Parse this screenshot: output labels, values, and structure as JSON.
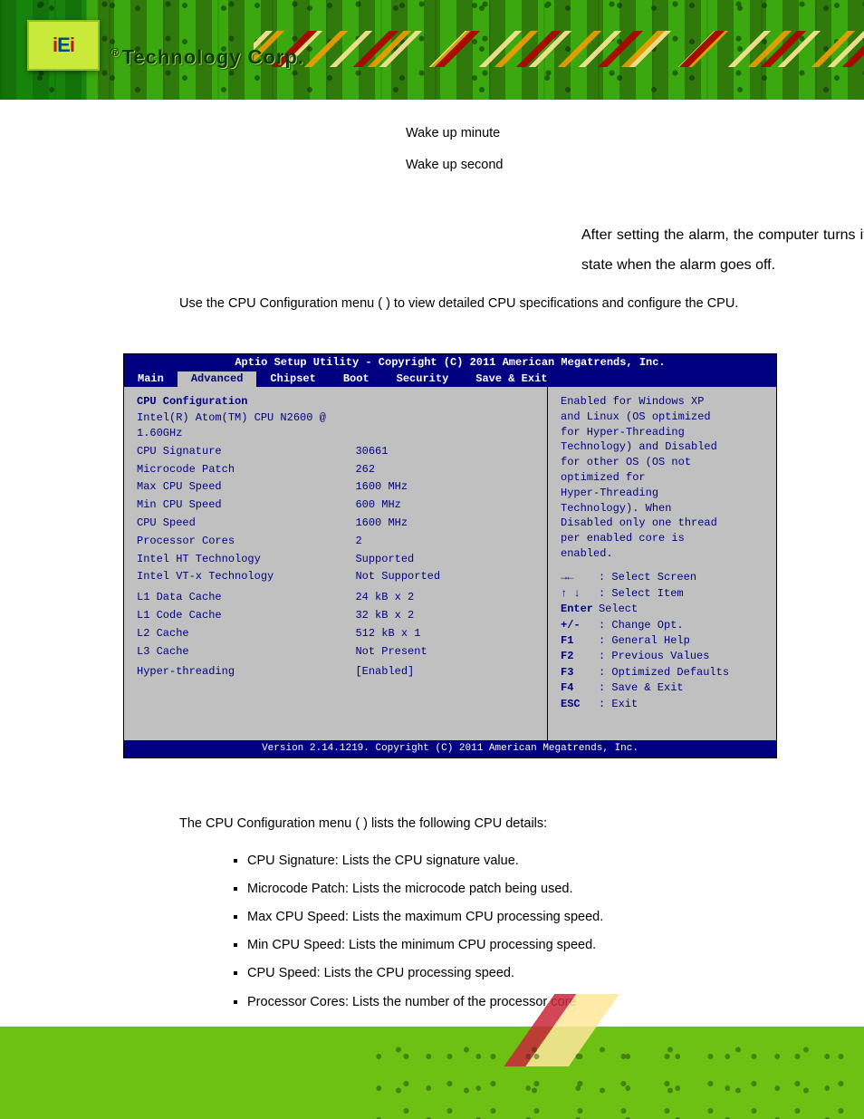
{
  "brand": {
    "logo_letters": "iEi",
    "logo_text": "Technology Corp."
  },
  "body": {
    "wake_minute": "Wake up minute",
    "wake_second": "Wake up second",
    "after_alarm": "After setting the alarm, the computer turns itself on from a suspend state when the alarm goes off.",
    "use_menu": "Use the CPU Configuration menu ( ) to view detailed CPU specifications and configure the CPU.",
    "details_intro": "The CPU Configuration menu ( ) lists the following CPU details:",
    "details": [
      "CPU Signature: Lists the CPU signature value.",
      "Microcode Patch: Lists the microcode patch being used.",
      "Max CPU Speed: Lists the maximum CPU processing speed.",
      "Min CPU Speed: Lists the minimum CPU processing speed.",
      "CPU Speed: Lists the CPU processing speed.",
      "Processor Cores: Lists the number of the processor core"
    ]
  },
  "bios": {
    "title": "Aptio Setup Utility - Copyright (C) 2011 American Megatrends, Inc.",
    "footer": "Version 2.14.1219. Copyright (C) 2011 American Megatrends, Inc.",
    "tabs": [
      "Main",
      "Advanced",
      "Chipset",
      "Boot",
      "Security",
      "Save & Exit"
    ],
    "section_heading": "CPU Configuration",
    "fields": [
      {
        "k": "Intel(R) Atom(TM) CPU N2600 @ 1.60GHz",
        "v": ""
      },
      {
        "k": "CPU Signature",
        "v": "30661"
      },
      {
        "k": "Microcode Patch",
        "v": "262"
      },
      {
        "k": "Max CPU Speed",
        "v": "1600 MHz"
      },
      {
        "k": "Min CPU Speed",
        "v": "600 MHz"
      },
      {
        "k": "CPU Speed",
        "v": "1600 MHz"
      },
      {
        "k": "Processor Cores",
        "v": "2"
      },
      {
        "k": "Intel HT Technology",
        "v": "Supported"
      },
      {
        "k": "Intel VT-x Technology",
        "v": "Not Supported"
      },
      {
        "k": "",
        "v": ""
      },
      {
        "k": "L1 Data Cache",
        "v": "24 kB x 2"
      },
      {
        "k": "L1 Code Cache",
        "v": "32 kB x 2"
      },
      {
        "k": "L2 Cache",
        "v": "512 kB x 1"
      },
      {
        "k": "L3 Cache",
        "v": "Not Present"
      },
      {
        "k": "",
        "v": ""
      },
      {
        "k": "Hyper-threading",
        "v": "[Enabled]"
      }
    ],
    "help": [
      "Enabled for Windows XP",
      "and Linux (OS optimized",
      "for Hyper-Threading",
      "Technology) and Disabled",
      "for other OS (OS not",
      "optimized for",
      "Hyper-Threading",
      "Technology). When",
      "Disabled only one thread",
      "per enabled core is",
      "enabled."
    ],
    "keys": [
      {
        "sym": "→←",
        "label": ": Select Screen"
      },
      {
        "sym": "↑ ↓",
        "label": ": Select Item"
      },
      {
        "sym": "Enter",
        "label": "Select"
      },
      {
        "sym": "+/-",
        "label": ": Change Opt."
      },
      {
        "sym": "F1",
        "label": ": General Help"
      },
      {
        "sym": "F2",
        "label": ": Previous Values"
      },
      {
        "sym": "F3",
        "label": ": Optimized Defaults"
      },
      {
        "sym": "F4",
        "label": ": Save & Exit"
      },
      {
        "sym": "ESC",
        "label": ": Exit"
      }
    ]
  }
}
